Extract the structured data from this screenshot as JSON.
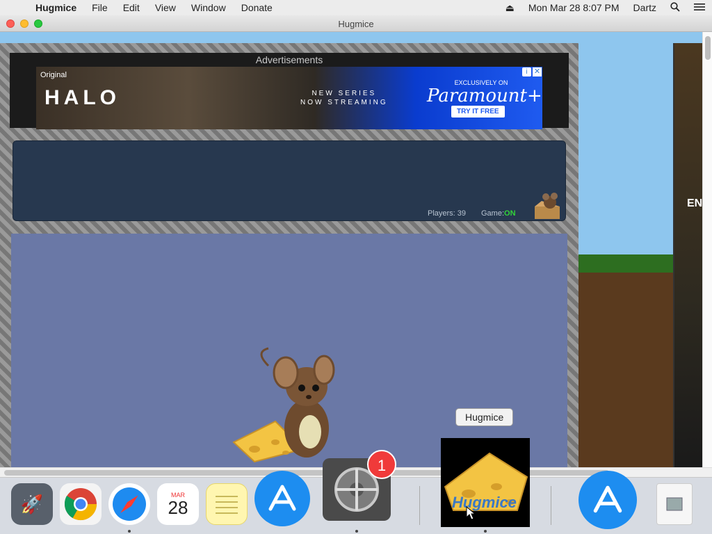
{
  "menubar": {
    "app_name": "Hugmice",
    "items": [
      "File",
      "Edit",
      "View",
      "Window",
      "Donate"
    ],
    "clock": "Mon Mar 28  8:07 PM",
    "user": "Dartz"
  },
  "window": {
    "title": "Hugmice"
  },
  "ads": {
    "label": "Advertisements",
    "banner": {
      "brand_tag": "Original",
      "headline": "HALO",
      "subtext_line1": "NEW SERIES",
      "subtext_line2": "NOW STREAMING",
      "exclusive": "EXCLUSIVELY ON",
      "network": "Paramount+",
      "cta": "TRY IT FREE"
    },
    "side_banner_text": "EN"
  },
  "status": {
    "players_label": "Players: 39",
    "game_label": "Game:",
    "game_state": "ON"
  },
  "dock": {
    "tooltip": "Hugmice",
    "calendar_month": "MAR",
    "calendar_day": "28",
    "notification_badge": "1",
    "hugmice_icon_text": "Hugmice",
    "apps": [
      "launchpad-icon",
      "chrome-icon",
      "safari-icon",
      "calendar-icon",
      "notes-icon",
      "app-store-icon",
      "system-preferences-icon",
      "hugmice-icon",
      "app-store-icon",
      "downloads-icon"
    ]
  },
  "colors": {
    "game_on": "#32d23a",
    "panel_bg": "#27384f",
    "playfield_bg": "#6a78a6",
    "paramount_blue": "#1f5bf0"
  }
}
